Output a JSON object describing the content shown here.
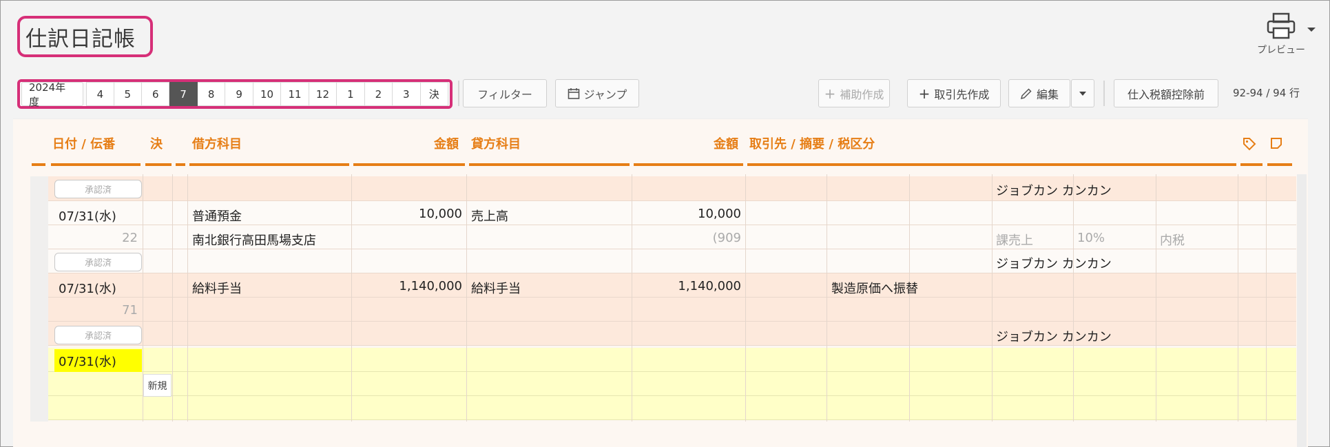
{
  "page": {
    "title": "仕訳日記帳"
  },
  "toolbar": {
    "preview_label": "プレビュー",
    "fiscal_year": "2024年度",
    "months": [
      "4",
      "5",
      "6",
      "7",
      "8",
      "9",
      "10",
      "11",
      "12",
      "1",
      "2",
      "3",
      "決"
    ],
    "active_month": "7",
    "filter_label": "フィルター",
    "jump_label": "ジャンプ",
    "aux_create_label": "補助作成",
    "partner_create_label": "取引先作成",
    "edit_label": "編集",
    "tax_label": "仕入税額控除前",
    "row_count": "92-94 / 94 行"
  },
  "table": {
    "headers": {
      "date": "日付 / 伝番",
      "settle": "決",
      "debit_account": "借方科目",
      "debit_amount": "金額",
      "credit_account": "貸方科目",
      "credit_amount": "金額",
      "partner": "取引先 / 摘要 / 税区分"
    },
    "rows": [
      {
        "badge": "承認済",
        "partner": "ジョブカン カンカン"
      },
      {
        "date": "07/31(水)",
        "debit_account": "普通預金",
        "debit_amount": "10,000",
        "credit_account": "売上高",
        "credit_amount": "10,000"
      },
      {
        "slip_no": "22",
        "debit_sub": "南北銀行高田馬場支店",
        "credit_sub": "(909",
        "tax_category": "課売上",
        "tax_rate": "10%",
        "tax_type": "内税"
      },
      {
        "badge": "承認済",
        "partner": "ジョブカン カンカン"
      },
      {
        "date": "07/31(水)",
        "debit_account": "給料手当",
        "debit_amount": "1,140,000",
        "credit_account": "給料手当",
        "credit_amount": "1,140,000",
        "memo": "製造原価へ振替"
      },
      {
        "slip_no": "71"
      },
      {
        "badge": "承認済",
        "partner": "ジョブカン カンカン"
      },
      {
        "date": "07/31(水)"
      },
      {
        "new_label": "新規"
      }
    ]
  },
  "colors": {
    "accent": "#e67e16",
    "highlight": "#d62f78",
    "active_month_bg": "#555555",
    "new_row_bg": "#ffffc8"
  }
}
